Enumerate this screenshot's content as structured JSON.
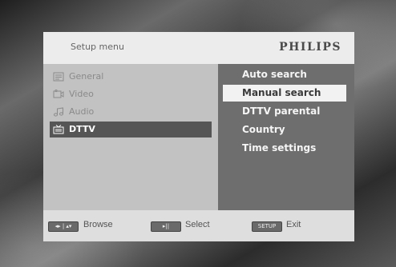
{
  "menu": {
    "title": "Setup menu",
    "brand": "PHILIPS"
  },
  "categories": [
    {
      "label": "General",
      "icon": "general-icon",
      "selected": false
    },
    {
      "label": "Video",
      "icon": "video-icon",
      "selected": false
    },
    {
      "label": "Audio",
      "icon": "audio-icon",
      "selected": false
    },
    {
      "label": "DTTV",
      "icon": "tv-icon",
      "selected": true
    }
  ],
  "options": [
    {
      "label": "Auto search",
      "selected": false
    },
    {
      "label": "Manual search",
      "selected": true
    },
    {
      "label": "DTTV parental",
      "selected": false
    },
    {
      "label": "Country",
      "selected": false
    },
    {
      "label": "Time settings",
      "selected": false
    }
  ],
  "footer": {
    "browse": {
      "key": "◂▸ | ▴▾",
      "label": "Browse"
    },
    "select": {
      "key": "▸||",
      "label": "Select"
    },
    "exit": {
      "key": "SETUP",
      "label": "Exit"
    }
  },
  "colors": {
    "header_bg": "#ececec",
    "left_pane_bg": "#c2c2c2",
    "right_pane_bg": "#6e6e6e",
    "selection_dark": "#555555",
    "selection_light": "#f2f2f2"
  }
}
